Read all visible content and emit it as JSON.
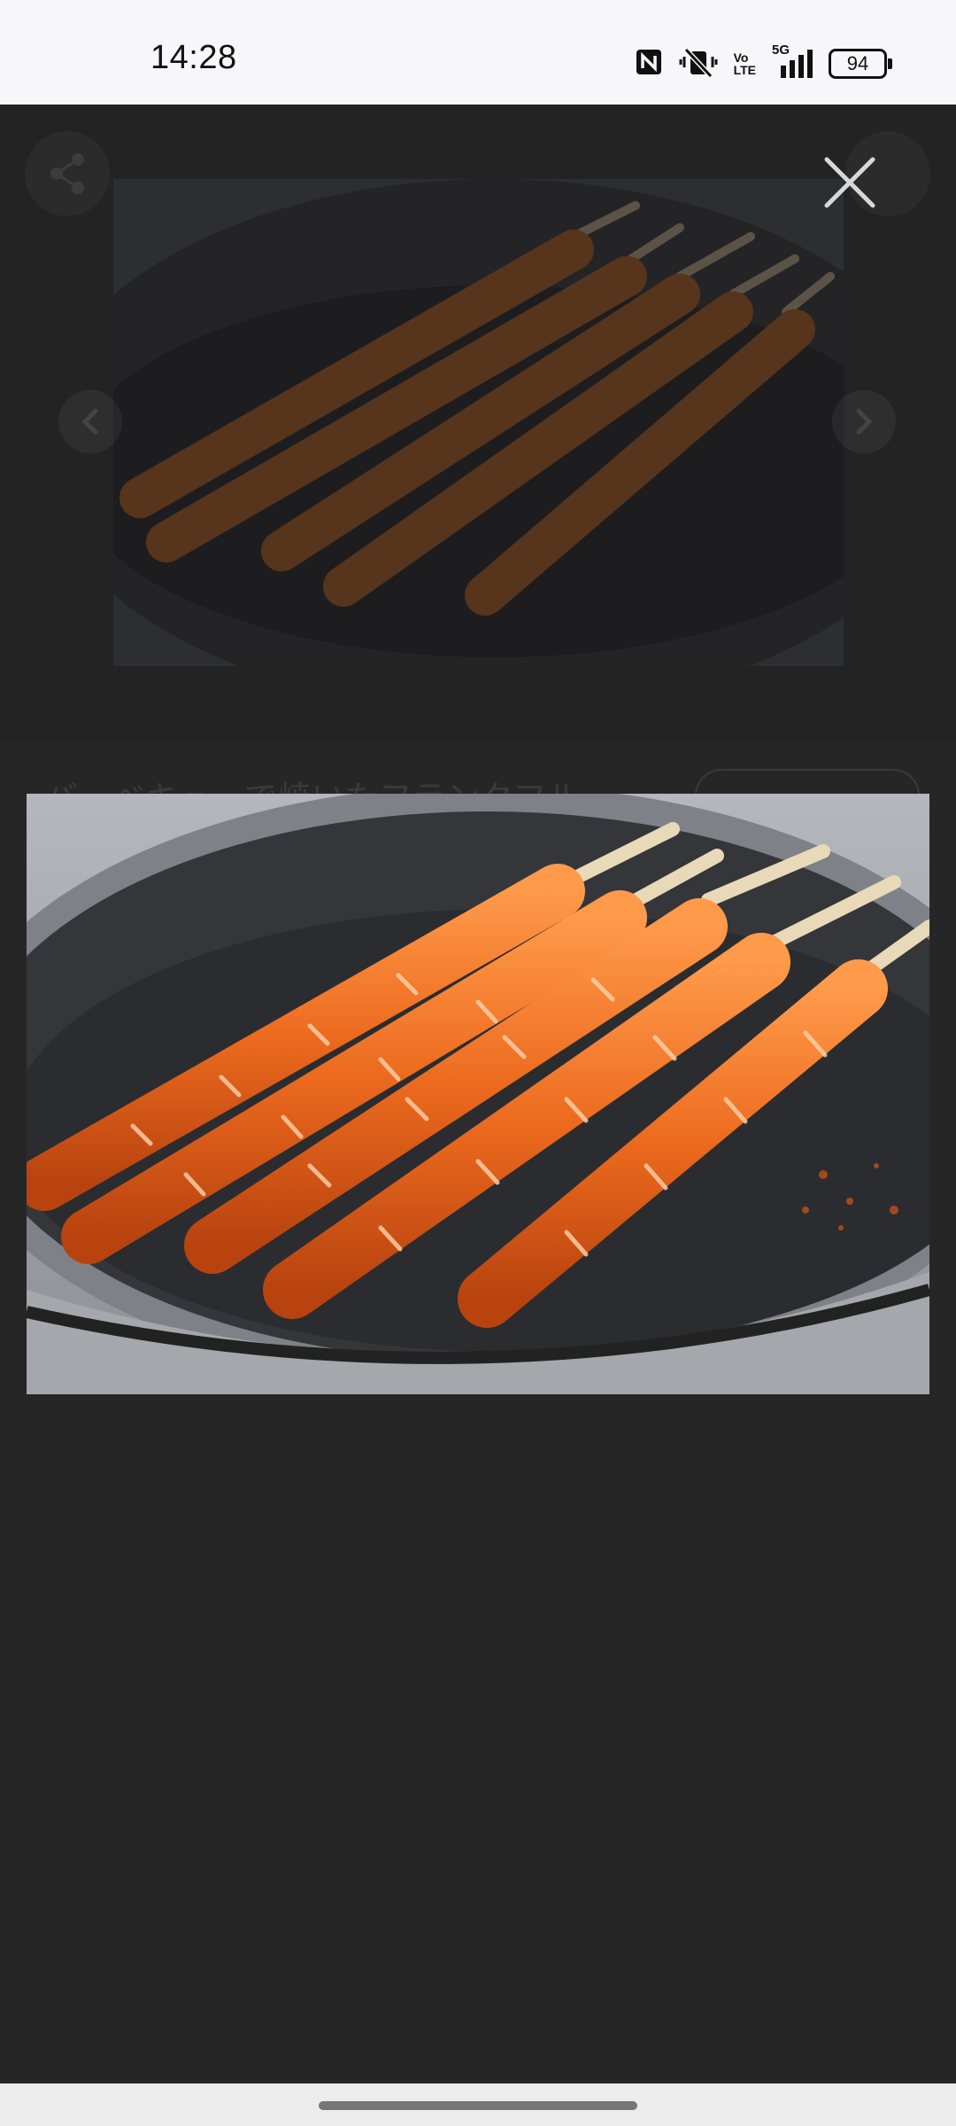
{
  "status_bar": {
    "time": "14:28",
    "network": "5G",
    "volte_top": "Vo",
    "volte_bottom": "LTE",
    "battery": "94"
  },
  "background_page": {
    "title_fragment": "バーベキューで焼いたフランクフル"
  },
  "icons": {
    "close": "close-icon",
    "share": "share-icon",
    "prev": "chevron-left-icon",
    "next": "chevron-right-icon",
    "nfc": "nfc-icon",
    "mute": "vibrate-mute-icon",
    "signal": "signal-icon"
  },
  "colors": {
    "sausage": "#e8641e",
    "pan": "#2c2d31",
    "scrim": "#232323"
  }
}
